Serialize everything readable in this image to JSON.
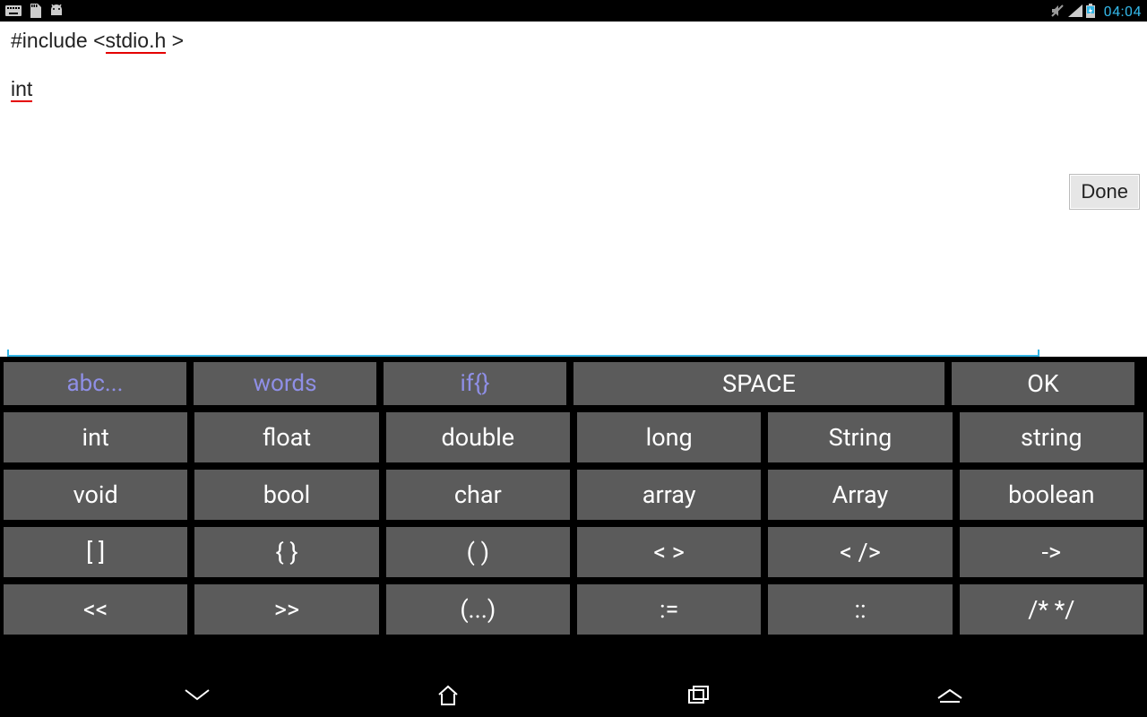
{
  "statusbar": {
    "clock": "04:04"
  },
  "editor": {
    "line1_prefix": "#include <",
    "line1_underlined": "stdio.h",
    "line1_suffix": " >",
    "line2_underlined": "int",
    "done_label": "Done"
  },
  "keyboard": {
    "top": {
      "k0": "abc...",
      "k1": "words",
      "k2": "if{}",
      "k3": "SPACE",
      "k4": "OK"
    },
    "row1": {
      "k0": "int",
      "k1": "float",
      "k2": "double",
      "k3": "long",
      "k4": "String",
      "k5": "string"
    },
    "row2": {
      "k0": "void",
      "k1": "bool",
      "k2": "char",
      "k3": "array",
      "k4": "Array",
      "k5": "boolean"
    },
    "row3": {
      "k0": "[ ]",
      "k1": "{ }",
      "k2": "( )",
      "k3": "< >",
      "k4": "< />",
      "k5": "->"
    },
    "row4": {
      "k0": "<<",
      "k1": ">>",
      "k2": "(...)",
      "k3": ":=",
      "k4": "::",
      "k5": "/* */"
    }
  }
}
